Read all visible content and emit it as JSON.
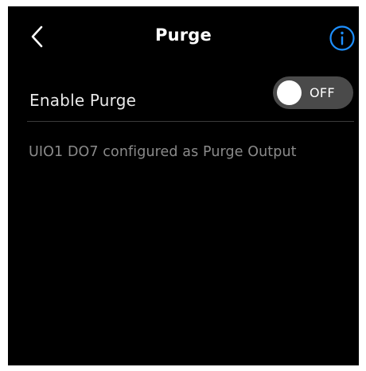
{
  "header": {
    "title": "Purge",
    "back_icon": "chevron-left-icon",
    "info_icon": "info-icon",
    "info_color": "#1e90ff"
  },
  "purge_setting": {
    "label": "Enable Purge",
    "toggle_state": "OFF",
    "enabled": false
  },
  "note": "UIO1 DO7 configured as Purge Output",
  "colors": {
    "background": "#000000",
    "toggle_track": "#4a4a4a",
    "note_text": "#8a8a8a"
  }
}
